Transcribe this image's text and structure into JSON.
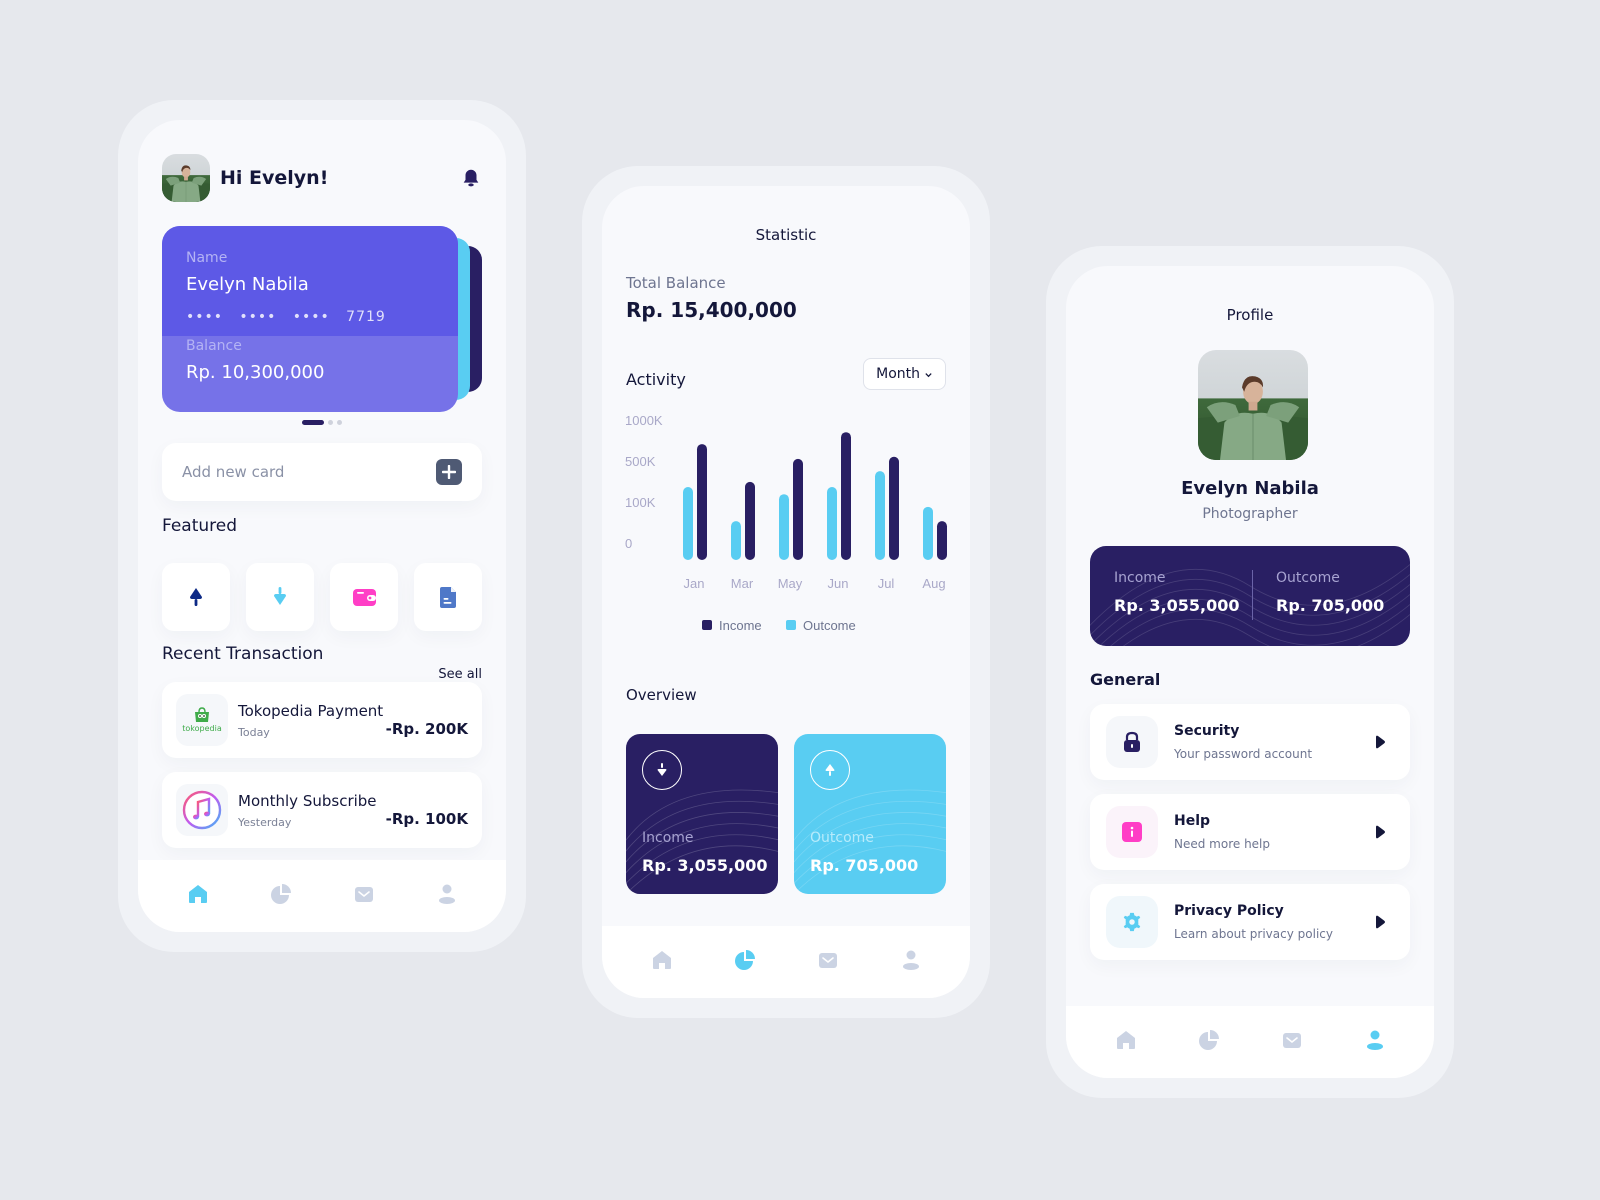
{
  "colors": {
    "background": "#e6e8ed",
    "primary_purple": "#5d59e6",
    "dark_navy": "#291f63",
    "sky_blue": "#59cdf2",
    "pink": "#ff3ec6",
    "doc_blue": "#4f78c8",
    "nav_inactive": "#cbd3e3"
  },
  "home": {
    "greeting": "Hi Evelyn!",
    "card": {
      "name_label": "Name",
      "name_value": "Evelyn Nabila",
      "masked_groups": [
        "••••",
        "••••",
        "••••"
      ],
      "last_digits": "7719",
      "balance_label": "Balance",
      "balance_value": "Rp. 10,300,000"
    },
    "carousel": {
      "count": 3,
      "active_index": 0
    },
    "add_card_placeholder": "Add new card",
    "featured_title": "Featured",
    "featured_items": [
      {
        "icon": "send-up-icon"
      },
      {
        "icon": "receive-down-icon"
      },
      {
        "icon": "wallet-icon"
      },
      {
        "icon": "document-icon"
      }
    ],
    "recent_title": "Recent Transaction",
    "see_all": "See all",
    "transactions": [
      {
        "title": "Tokopedia Payment",
        "date": "Today",
        "amount": "-Rp. 200K",
        "icon": "tokopedia-logo",
        "logo_text": "tokopedia"
      },
      {
        "title": "Monthly Subscribe",
        "date": "Yesterday",
        "amount": "-Rp. 100K",
        "icon": "music-note-icon"
      }
    ],
    "nav_active": "home"
  },
  "statistic": {
    "title": "Statistic",
    "total_balance_label": "Total Balance",
    "total_balance_value": "Rp. 15,400,000",
    "activity_label": "Activity",
    "period_select": "Month",
    "overview_title": "Overview",
    "overview": {
      "income_label": "Income",
      "income_value": "Rp. 3,055,000",
      "outcome_label": "Outcome",
      "outcome_value": "Rp. 705,000"
    },
    "nav_active": "statistic"
  },
  "chart_data": {
    "type": "bar",
    "title": "Activity",
    "xlabel": "",
    "ylabel": "",
    "categories": [
      "Jan",
      "Mar",
      "May",
      "Jun",
      "Jul",
      "Aug"
    ],
    "y_ticks": [
      "1000K",
      "500K",
      "100K",
      "0"
    ],
    "y_tick_values": [
      1000,
      500,
      100,
      0
    ],
    "ylim": [
      0,
      1000
    ],
    "units": "K",
    "grid": false,
    "legend_position": "bottom-center",
    "series": [
      {
        "name": "Outcome",
        "color": "#59cdf2",
        "values": [
          285,
          63,
          215,
          285,
          440,
          98
        ]
      },
      {
        "name": "Income",
        "color": "#291f63",
        "values": [
          755,
          335,
          575,
          900,
          600,
          63
        ]
      }
    ],
    "legend": [
      "Income",
      "Outcome"
    ]
  },
  "profile": {
    "title": "Profile",
    "name": "Evelyn Nabila",
    "role": "Photographer",
    "income_label": "Income",
    "income_value": "Rp. 3,055,000",
    "outcome_label": "Outcome",
    "outcome_value": "Rp. 705,000",
    "general_title": "General",
    "settings": [
      {
        "title": "Security",
        "subtitle": "Your password account",
        "icon": "lock-icon"
      },
      {
        "title": "Help",
        "subtitle": "Need more help",
        "icon": "info-icon"
      },
      {
        "title": "Privacy Policy",
        "subtitle": "Learn about privacy policy",
        "icon": "gear-icon"
      }
    ],
    "nav_active": "profile"
  },
  "nav_items": [
    "home",
    "statistic",
    "messages",
    "profile"
  ]
}
